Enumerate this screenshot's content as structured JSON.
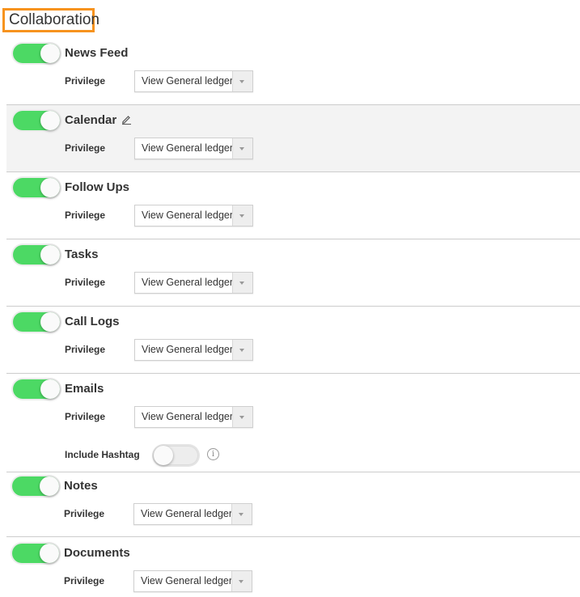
{
  "section": {
    "title": "Collaboration",
    "highlight_color": "#f7931e"
  },
  "colors": {
    "toggle_on": "#4cd964",
    "toggle_off": "#ededed",
    "row_highlight": "#f3f3f3"
  },
  "modules": [
    {
      "name": "News Feed",
      "enabled": true,
      "privilege_label": "Privilege",
      "privilege_value": "View General ledger"
    },
    {
      "name": "Calendar",
      "enabled": true,
      "privilege_label": "Privilege",
      "privilege_value": "View General ledger",
      "edit_icon": "pencil-icon",
      "highlighted": true
    },
    {
      "name": "Follow Ups",
      "enabled": true,
      "privilege_label": "Privilege",
      "privilege_value": "View General ledger"
    },
    {
      "name": "Tasks",
      "enabled": true,
      "privilege_label": "Privilege",
      "privilege_value": "View General ledger"
    },
    {
      "name": "Call Logs",
      "enabled": true,
      "privilege_label": "Privilege",
      "privilege_value": "View General ledger"
    },
    {
      "name": "Emails",
      "enabled": true,
      "privilege_label": "Privilege",
      "privilege_value": "View General ledger",
      "include_hashtag": {
        "label": "Include Hashtag",
        "enabled": false,
        "info_icon": "i"
      }
    },
    {
      "name": "Notes",
      "enabled": true,
      "privilege_label": "Privilege",
      "privilege_value": "View General ledger"
    },
    {
      "name": "Documents",
      "enabled": true,
      "privilege_label": "Privilege",
      "privilege_value": "View General ledger"
    }
  ]
}
